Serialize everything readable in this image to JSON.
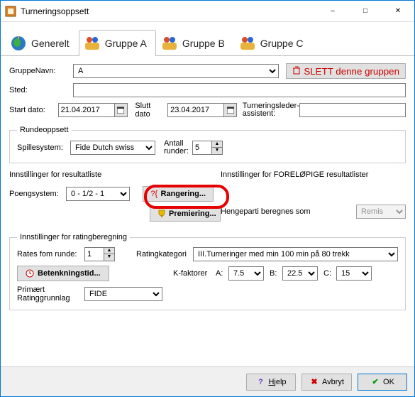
{
  "window": {
    "title": "Turneringsoppsett"
  },
  "tabs": [
    {
      "label": "Generelt",
      "active": false
    },
    {
      "label": "Gruppe A",
      "active": true
    },
    {
      "label": "Gruppe B",
      "active": false
    },
    {
      "label": "Gruppe C",
      "active": false
    }
  ],
  "group": {
    "name_label": "GruppeNavn:",
    "name_value": "A",
    "delete_label": "SLETT denne gruppen",
    "place_label": "Sted:",
    "place_value": "",
    "start_date_label": "Start dato:",
    "start_date_value": "21.04.2017",
    "end_date_label": "Slutt dato",
    "end_date_value": "23.04.2017",
    "td_assistant_label": "Turneringsleder-assistent:",
    "td_assistant_value": ""
  },
  "rounds": {
    "legend": "Rundeoppsett",
    "system_label": "Spillesystem:",
    "system_value": "Fide Dutch swiss",
    "count_label": "Antall runder:",
    "count_value": "5"
  },
  "results": {
    "left_title": "Innstillinger for resultatliste",
    "scoring_label": "Poengsystem:",
    "scoring_value": "0 - 1/2 - 1",
    "ranking_button": "Rangering...",
    "awards_button": "Premiering...",
    "right_title": "Innstillinger for FORELØPIGE resultatlister",
    "adjourned_label": "Hengeparti beregnes som",
    "adjourned_value": "Remis"
  },
  "rating": {
    "legend": "Innstillinger for ratingberegning",
    "from_round_label": "Rates fom runde:",
    "from_round_value": "1",
    "category_label": "Ratingkategori",
    "category_value": "III.Turneringer med min 100 min på 80 trekk",
    "time_button": "Betenkningstid...",
    "kfactor_label": "K-faktorer",
    "k_a_label": "A:",
    "k_a_value": "7.5",
    "k_b_label": "B:",
    "k_b_value": "22.5",
    "k_c_label": "C:",
    "k_c_value": "15",
    "basis_label": "Primært Ratinggrunnlag",
    "basis_value": "FIDE"
  },
  "footer": {
    "help": "Hjelp",
    "cancel": "Avbryt",
    "ok": "OK"
  }
}
